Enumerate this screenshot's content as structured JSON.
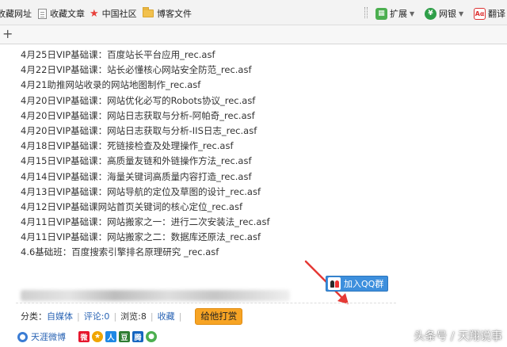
{
  "bookmarks": [
    {
      "label": "收藏网址",
      "icon": "page-icon"
    },
    {
      "label": "收藏文章",
      "icon": "page-icon"
    },
    {
      "label": "中国社区",
      "icon": "star-icon"
    },
    {
      "label": "博客文件",
      "icon": "folder-icon"
    }
  ],
  "extensions": {
    "expand": "扩展",
    "bank": "网银",
    "translate": "翻译"
  },
  "list_items": [
    "4月25日VIP基础课：百度站长平台应用_rec.asf",
    "4月22日VIP基础课：站长必懂核心网站安全防范_rec.asf",
    "4月21助推网站收录的网站地图制作_rec.asf",
    "4月20日VIP基础课：网站优化必写的Robots协议_rec.asf",
    "4月20日VIP基础课：网站日志获取与分析-阿帕奇_rec.asf",
    "4月20日VIP基础课：网站日志获取与分析-IIS日志_rec.asf",
    "4月18日VIP基础课：死链接检查及处理操作_rec.asf",
    "4月15日VIP基础课：高质量友链和外链操作方法_rec.asf",
    "4月14日VIP基础课：海量关键词高质量内容打造_rec.asf",
    "4月13日VIP基础课：网站导航的定位及草图的设计_rec.asf",
    "4月12日VIP基础课网站首页关键词的核心定位_rec.asf",
    "4月11日VIP基础课：网站搬家之一：进行二次安装法_rec.asf",
    "4月11日VIP基础课：网站搬家之二：数据库还原法_rec.asf",
    "4.6基础班：百度搜索引擎排名原理研究 _rec.asf"
  ],
  "qq_button": "加入QQ群",
  "meta": {
    "category_label": "分类：",
    "category": "自媒体",
    "comments": "评论:0",
    "views": "浏览:8",
    "favorite": "收藏",
    "tip": "给他打赏"
  },
  "share": {
    "weibo": "天涯微博"
  },
  "watermark": "头条号 / 天翔说事",
  "colors": {
    "accent_blue": "#3d8fdd",
    "link": "#2a64b4",
    "tip_orange": "#f7a424",
    "arrow_red": "#e53935"
  }
}
